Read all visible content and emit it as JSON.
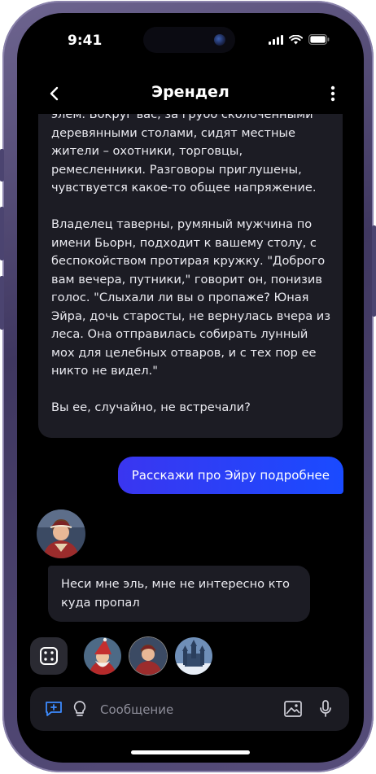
{
  "status": {
    "time": "9:41"
  },
  "header": {
    "title": "Эрендел"
  },
  "messages": {
    "bot_long": "элем.  Вокруг вас, за грубо сколоченными деревянными столами, сидят местные жители – охотники, торговцы, ремесленники.  Разговоры приглушены, чувствуется какое-то общее напряжение.\n\nВладелец таверны,  румяный мужчина по имени Бьорн,  подходит к вашему столу, с беспокойством протирая кружку. \"Доброго вам вечера, путники,\" говорит он, понизив голос. \"Слыхали ли вы о пропаже?  Юная Эйра, дочь старосты, не вернулась вчера из леса. Она отправилась собирать лунный мох для целебных отваров,  и с тех пор ее никто не видел.\"\n\nВы ее, случайно, не встречали?",
    "user": "Расскажи про Эйру подробнее",
    "bot_reply": "Неси мне эль, мне не интересно кто куда пропал"
  },
  "composer": {
    "placeholder": "Сообщение"
  },
  "icons": {
    "back": "chevron-left-icon",
    "menu": "more-vertical-icon",
    "dice": "dice-icon",
    "chat": "chat-plus-icon",
    "bulb": "lightbulb-icon",
    "image": "image-icon",
    "mic": "microphone-icon"
  },
  "colors": {
    "accent": "#2a44ff",
    "bubble": "#1c1c24",
    "screen": "#000000",
    "composer_icon": "#3d8bff"
  }
}
